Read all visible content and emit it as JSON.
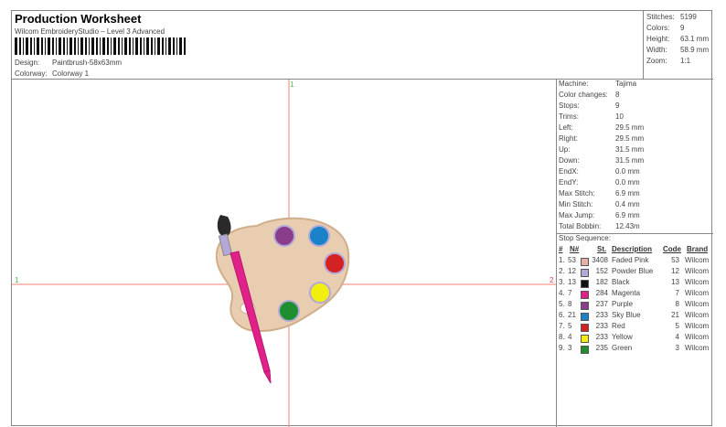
{
  "header": {
    "title": "Production Worksheet",
    "subtitle": "Wilcom EmbroideryStudio – Level 3 Advanced",
    "design_label": "Design:",
    "design_value": "Paintbrush-58x63mm",
    "colorway_label": "Colorway:",
    "colorway_value": "Colorway 1"
  },
  "stats": [
    {
      "label": "Stitches:",
      "value": "5199"
    },
    {
      "label": "Colors:",
      "value": "9"
    },
    {
      "label": "Height:",
      "value": "63.1 mm"
    },
    {
      "label": "Width:",
      "value": "58.9 mm"
    },
    {
      "label": "Zoom:",
      "value": "1:1"
    }
  ],
  "canvas": {
    "marker_top": "1",
    "marker_left": "1",
    "marker_right": "2"
  },
  "machine_info": [
    {
      "label": "Machine:",
      "value": "Tajima"
    },
    {
      "label": "Color changes:",
      "value": "8"
    },
    {
      "label": "Stops:",
      "value": "9"
    },
    {
      "label": "Trims:",
      "value": "10"
    },
    {
      "label": "Left:",
      "value": "29.5 mm"
    },
    {
      "label": "Right:",
      "value": "29.5 mm"
    },
    {
      "label": "Up:",
      "value": "31.5 mm"
    },
    {
      "label": "Down:",
      "value": "31.5 mm"
    },
    {
      "label": "EndX:",
      "value": "0.0 mm"
    },
    {
      "label": "EndY:",
      "value": "0.0 mm"
    },
    {
      "label": "Max Stitch:",
      "value": "6.9 mm"
    },
    {
      "label": "Min Stitch:",
      "value": "0.4 mm"
    },
    {
      "label": "Max Jump:",
      "value": "6.9 mm"
    },
    {
      "label": "Total Bobbin:",
      "value": "12.43m"
    }
  ],
  "stop_sequence": {
    "title": "Stop Sequence:",
    "headers": {
      "num": "#",
      "n": "N#",
      "st": "St.",
      "description": "Description",
      "code": "Code",
      "brand": "Brand"
    },
    "rows": [
      {
        "num": "1.",
        "n": "53",
        "color": "#e6b1a4",
        "st": "3408",
        "description": "Faded Pink",
        "code": "53",
        "brand": "Wilcom"
      },
      {
        "num": "2.",
        "n": "12",
        "color": "#b3a9d8",
        "st": "152",
        "description": "Powder Blue",
        "code": "12",
        "brand": "Wilcom"
      },
      {
        "num": "3.",
        "n": "13",
        "color": "#111111",
        "st": "182",
        "description": "Black",
        "code": "13",
        "brand": "Wilcom"
      },
      {
        "num": "4.",
        "n": "7",
        "color": "#e0218a",
        "st": "284",
        "description": "Magenta",
        "code": "7",
        "brand": "Wilcom"
      },
      {
        "num": "5.",
        "n": "8",
        "color": "#8a3d8a",
        "st": "237",
        "description": "Purple",
        "code": "8",
        "brand": "Wilcom"
      },
      {
        "num": "6.",
        "n": "21",
        "color": "#1a82c8",
        "st": "233",
        "description": "Sky Blue",
        "code": "21",
        "brand": "Wilcom"
      },
      {
        "num": "7.",
        "n": "5",
        "color": "#d42222",
        "st": "233",
        "description": "Red",
        "code": "5",
        "brand": "Wilcom"
      },
      {
        "num": "8.",
        "n": "4",
        "color": "#f2ee10",
        "st": "233",
        "description": "Yellow",
        "code": "4",
        "brand": "Wilcom"
      },
      {
        "num": "9.",
        "n": "3",
        "color": "#1e8e2e",
        "st": "235",
        "description": "Green",
        "code": "3",
        "brand": "Wilcom"
      }
    ]
  },
  "design_colors": {
    "palette_fill": "#e9cdb0",
    "palette_edge": "#cfae8c",
    "brush_handle": "#e0218a",
    "brush_ferrule": "#b3a9d8",
    "brush_tip": "#2a2a2a"
  }
}
